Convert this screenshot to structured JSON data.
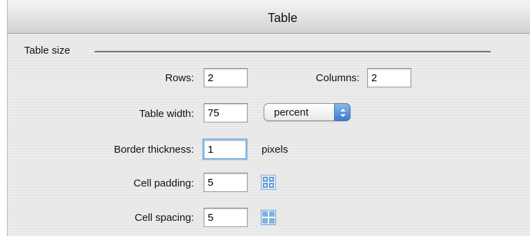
{
  "dialog": {
    "title": "Table"
  },
  "table_size": {
    "section_label": "Table size",
    "rows_label": "Rows:",
    "rows_value": "2",
    "columns_label": "Columns:",
    "columns_value": "2",
    "width_label": "Table width:",
    "width_value": "75",
    "width_unit_selected": "percent",
    "border_label": "Border thickness:",
    "border_value": "1",
    "border_unit": "pixels",
    "padding_label": "Cell padding:",
    "padding_value": "5",
    "spacing_label": "Cell spacing:",
    "spacing_value": "5"
  },
  "icons": {
    "select_arrows": "up-down-chevron-icon",
    "cell_padding": "cell-padding-icon",
    "cell_spacing": "cell-spacing-icon"
  },
  "colors": {
    "accent": "#3b7bd0",
    "focus_ring": "#9cc4ec",
    "icon_blue": "#5b9bd5"
  }
}
